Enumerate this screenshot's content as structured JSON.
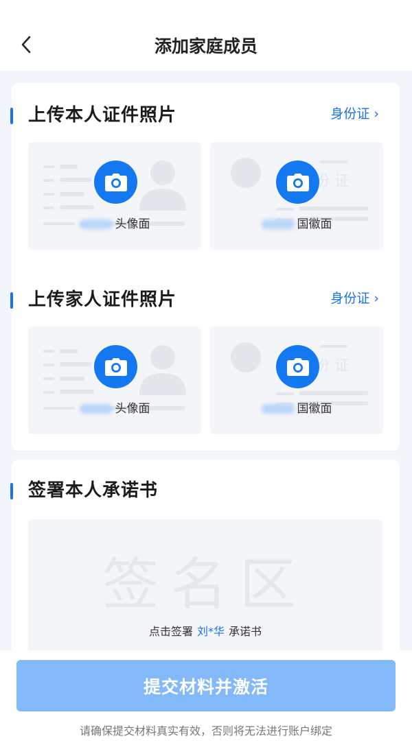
{
  "header": {
    "title": "添加家庭成员"
  },
  "sections": {
    "self": {
      "title": "上传本人证件照片",
      "link": "身份证"
    },
    "family": {
      "title": "上传家人证件照片",
      "link": "身份证"
    },
    "sign": {
      "title": "签署本人承诺书"
    }
  },
  "id_cards": {
    "front_label": "头像面",
    "back_label": "国徽面",
    "back_deco_text": "份 证"
  },
  "signature": {
    "placeholder": "签名区",
    "hint_prefix": "点击签署",
    "signer_name": "刘*华",
    "hint_suffix": "承诺书"
  },
  "footer": {
    "submit_label": "提交材料并激活",
    "note": "请确保提交材料真实有效，否则将无法进行账户绑定"
  },
  "colors": {
    "accent": "#1478f0",
    "button_disabled": "#83b8f9",
    "page_bg": "#f2f6fa"
  }
}
